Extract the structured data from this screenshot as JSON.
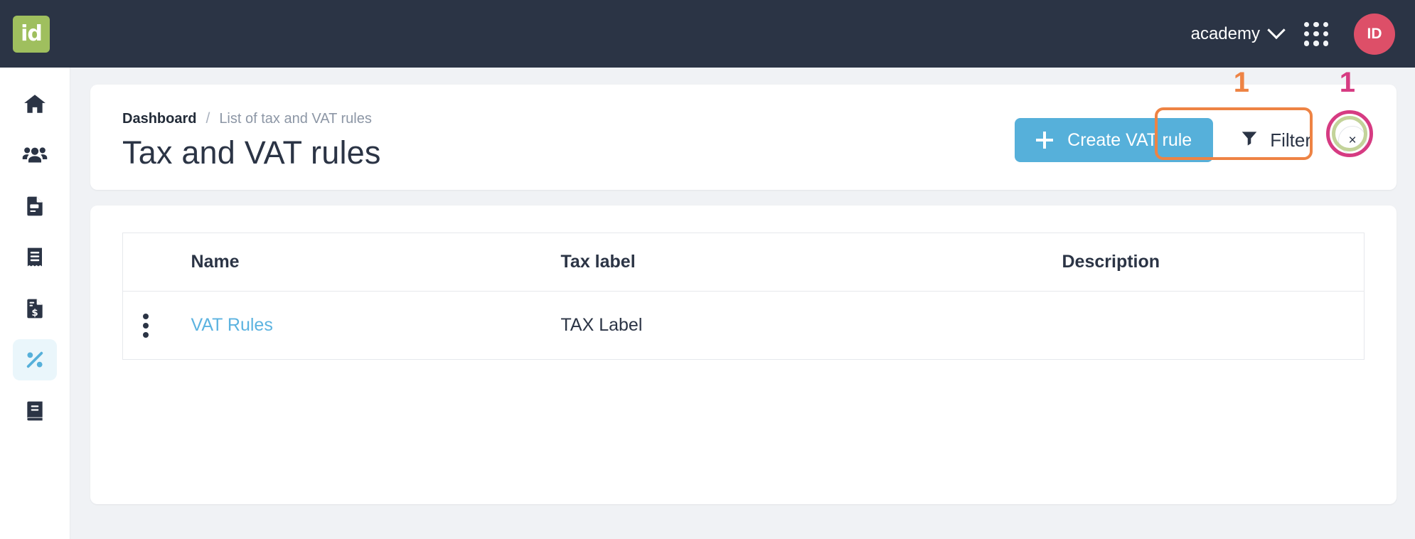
{
  "topbar": {
    "logo_text": "id",
    "logo_icon": "id-logo",
    "org_name": "academy",
    "org_chevron_icon": "chevron-down-icon",
    "apps_icon": "apps-grid-icon",
    "avatar_initials": "ID",
    "bg_color": "#2b3445",
    "avatar_color": "#dd4f68",
    "logo_color": "#9fbf5e"
  },
  "sidebar": {
    "items": [
      {
        "name": "home",
        "icon": "home-icon",
        "active": false
      },
      {
        "name": "customers",
        "icon": "people-icon",
        "active": false
      },
      {
        "name": "quotes",
        "icon": "document-contract-icon",
        "active": false
      },
      {
        "name": "receipts",
        "icon": "receipt-icon",
        "active": false
      },
      {
        "name": "invoices",
        "icon": "invoice-dollar-icon",
        "active": false
      },
      {
        "name": "tax-vat-rules",
        "icon": "percent-icon",
        "active": true
      },
      {
        "name": "ledger",
        "icon": "book-icon",
        "active": false
      }
    ],
    "active_bg": "#eaf6fb",
    "active_color": "#56b0da"
  },
  "breadcrumb": {
    "root": "Dashboard",
    "separator": "/",
    "current": "List of tax and VAT rules"
  },
  "page": {
    "title": "Tax and VAT rules"
  },
  "toolbar": {
    "create_label": "Create VAT rule",
    "create_icon": "plus-icon",
    "create_color": "#56b0da",
    "filter_label": "Filter",
    "filter_icon": "funnel-icon",
    "close_label": "×",
    "close_icon": "close-icon"
  },
  "annotations": [
    {
      "number": "1",
      "target": "filter-button",
      "color": "#ee8344",
      "shape": "rounded-rect"
    },
    {
      "number": "1",
      "target": "close-button",
      "color": "#d63b82",
      "shape": "circle",
      "inner_color": "#c3d39a"
    }
  ],
  "table": {
    "columns": [
      "",
      "Name",
      "Tax label",
      "Description"
    ],
    "rows": [
      {
        "menu_icon": "kebab-menu-icon",
        "name": "VAT Rules",
        "tax_label": "TAX Label",
        "description": ""
      }
    ]
  }
}
